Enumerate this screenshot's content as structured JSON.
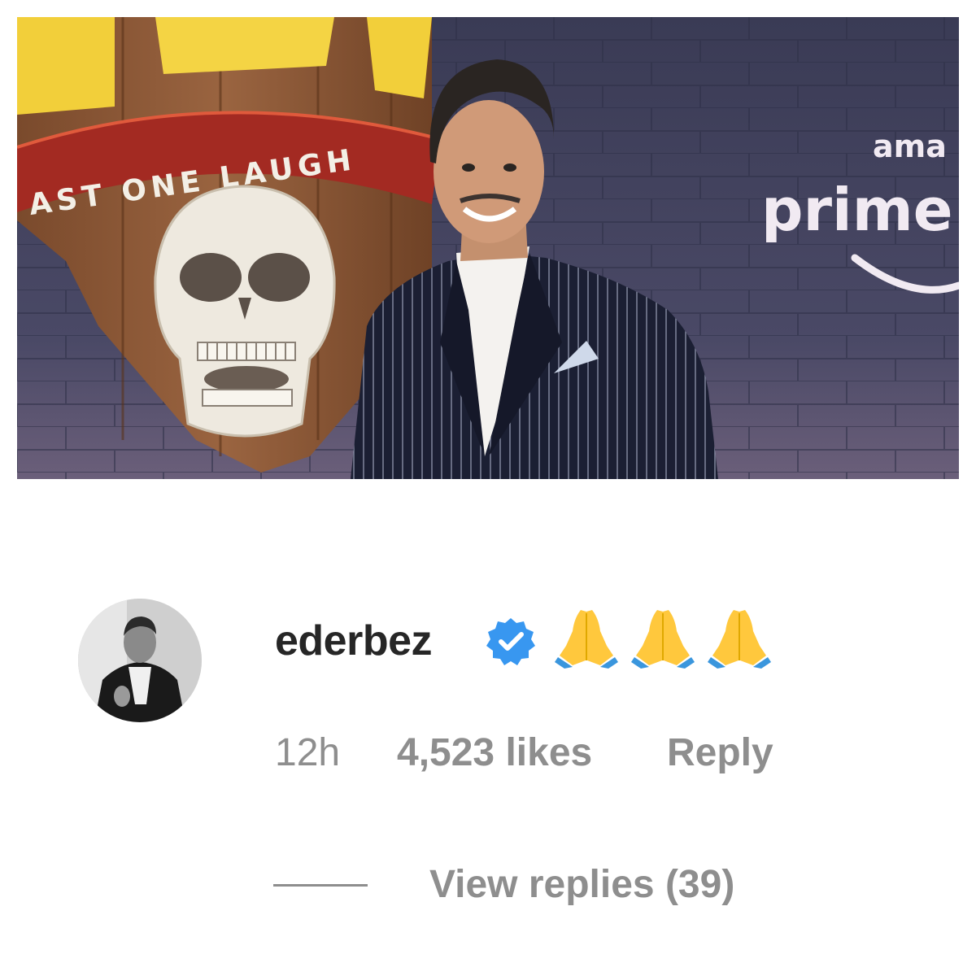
{
  "photo": {
    "banner_text": "AST ONE LAUGH",
    "brand_top": "ama",
    "brand_bottom": "prime"
  },
  "comment": {
    "username": "ederbez",
    "verified": true,
    "emoji_text": "🙏🙏🙏",
    "time": "12h",
    "likes": "4,523 likes",
    "reply_label": "Reply",
    "view_replies": "View replies (39)"
  },
  "colors": {
    "username": "#262626",
    "meta": "#8e8e8e",
    "verified_badge": "#3897f0",
    "emoji_skin": "#ffc83d",
    "emoji_sleeve": "#3a96dd"
  }
}
